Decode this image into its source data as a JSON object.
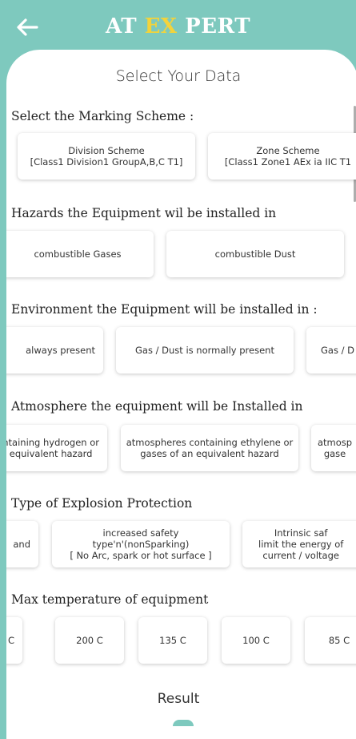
{
  "header": {
    "logo_part1": "AT",
    "logo_part2": "EX",
    "logo_part3": "PERT"
  },
  "page_title": "Select Your Data",
  "sections": [
    {
      "label": "Select the Marking Scheme :",
      "options": [
        "Division Scheme\n[Class1 Division1 GroupA,B,C T1]",
        "Zone Scheme\n[Class1 Zone1 AEx ia IIC T1"
      ]
    },
    {
      "label": "Hazards the Equipment wil be installed in",
      "options": [
        "combustible Gases",
        "combustible Dust"
      ]
    },
    {
      "label": "Environment the Equipment will be installed in :",
      "options": [
        "always present",
        "Gas / Dust is normally present",
        "Gas / D"
      ]
    },
    {
      "label": "Atmosphere the equipment will be Installed in",
      "options": [
        "ntaining hydrogen or\nequivalent hazard",
        "atmospheres containing ethylene or\ngases of an equivalent hazard",
        "atmosp\ngase"
      ]
    },
    {
      "label": "Type of Explosion Protection",
      "options": [
        "and",
        "increased safety\ntype'n'(nonSparking)\n[ No Arc, spark or hot surface ]",
        "Intrinsic saf\nlimit the energy of\ncurrent / voltage"
      ]
    },
    {
      "label": "Max temperature of equipment",
      "options": [
        "C",
        "200 C",
        "135 C",
        "100 C",
        "85 C"
      ]
    }
  ],
  "result_label": "Result",
  "colors": {
    "background": "#7ec9be",
    "logo_accent": "#f3d33b",
    "card": "#ffffff"
  },
  "icons": {
    "back": "arrow-left-icon"
  }
}
